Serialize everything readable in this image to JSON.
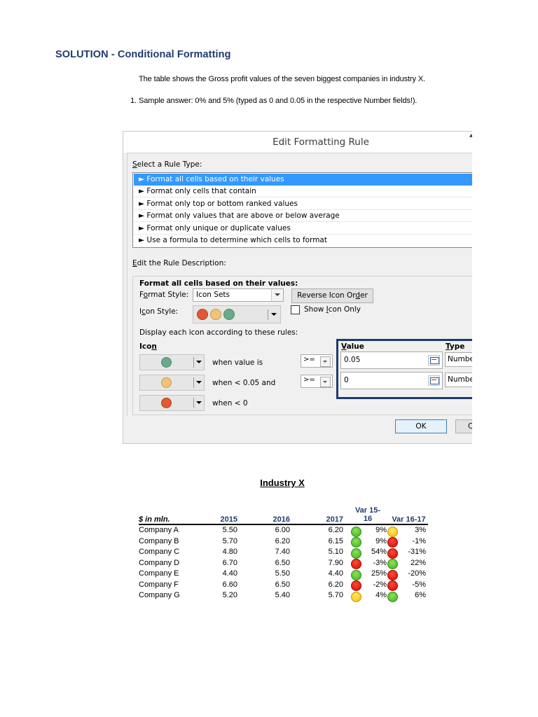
{
  "heading": "SOLUTION - Conditional Formatting",
  "intro": "The table shows the Gross profit values of the seven biggest companies in industry X.",
  "answer": {
    "number": "1.",
    "text": "Sample answer: 0% and 5% (typed as 0 and 0.05 in the respective Number fields!)."
  },
  "dialog": {
    "title": "Edit Formatting Rule",
    "select_rule_type_label": "Select a Rule Type:",
    "rule_types": [
      "► Format all cells based on their values",
      "► Format only cells that contain",
      "► Format only top or bottom ranked values",
      "► Format only values that are above or below average",
      "► Format only unique or duplicate values",
      "► Use a formula to determine which cells to format"
    ],
    "edit_desc_label": "Edit the Rule Description:",
    "desc_heading": "Format all cells based on their values:",
    "format_style_label": "Format Style:",
    "format_style_value": "Icon Sets",
    "reverse_icon_order": "Reverse Icon Order",
    "icon_style_label": "Icon Style:",
    "show_icon_only": "Show Icon Only",
    "display_rules_label": "Display each icon according to these rules:",
    "icon_col": "Icon",
    "value_col": "Value",
    "type_col": "Type",
    "rules": [
      {
        "icon": "green-circle",
        "condition": "when value is",
        "operator": ">=",
        "value": "0.05",
        "type": "Numbe"
      },
      {
        "icon": "yellow-circle",
        "condition": "when < 0.05 and",
        "operator": ">=",
        "value": "0",
        "type": "Numbe"
      },
      {
        "icon": "red-circle",
        "condition": "when < 0",
        "operator": "",
        "value": "",
        "type": ""
      }
    ],
    "ok": "OK",
    "cancel": "C"
  },
  "table": {
    "title": "Industry X",
    "headers": {
      "label": "$ in mln.",
      "y2015": "2015",
      "y2016": "2016",
      "y2017": "2017",
      "var1": "Var 15-\n16",
      "var2": "Var 16-17"
    },
    "rows": [
      {
        "company": "Company A",
        "v2015": "5.50",
        "v2016": "6.00",
        "v2017": "6.20",
        "var1": "9%",
        "var1_icon": "green",
        "var2": "3%",
        "var2_icon": "yellow"
      },
      {
        "company": "Company B",
        "v2015": "5.70",
        "v2016": "6.20",
        "v2017": "6.15",
        "var1": "9%",
        "var1_icon": "green",
        "var2": "-1%",
        "var2_icon": "red"
      },
      {
        "company": "Company C",
        "v2015": "4.80",
        "v2016": "7.40",
        "v2017": "5.10",
        "var1": "54%",
        "var1_icon": "green",
        "var2": "-31%",
        "var2_icon": "red"
      },
      {
        "company": "Company D",
        "v2015": "6.70",
        "v2016": "6.50",
        "v2017": "7.90",
        "var1": "-3%",
        "var1_icon": "red",
        "var2": "22%",
        "var2_icon": "green"
      },
      {
        "company": "Company E",
        "v2015": "4.40",
        "v2016": "5.50",
        "v2017": "4.40",
        "var1": "25%",
        "var1_icon": "green",
        "var2": "-20%",
        "var2_icon": "red"
      },
      {
        "company": "Company F",
        "v2015": "6.60",
        "v2016": "6.50",
        "v2017": "6.20",
        "var1": "-2%",
        "var1_icon": "red",
        "var2": "-5%",
        "var2_icon": "red"
      },
      {
        "company": "Company G",
        "v2015": "5.20",
        "v2016": "5.40",
        "v2017": "5.70",
        "var1": "4%",
        "var1_icon": "yellow",
        "var2": "6%",
        "var2_icon": "green"
      }
    ]
  },
  "colors": {
    "heading": "#1f3a6e",
    "selection": "#3399ff",
    "icon_green": "#3db21d",
    "icon_yellow": "#f0c000",
    "icon_red": "#d20a00"
  }
}
